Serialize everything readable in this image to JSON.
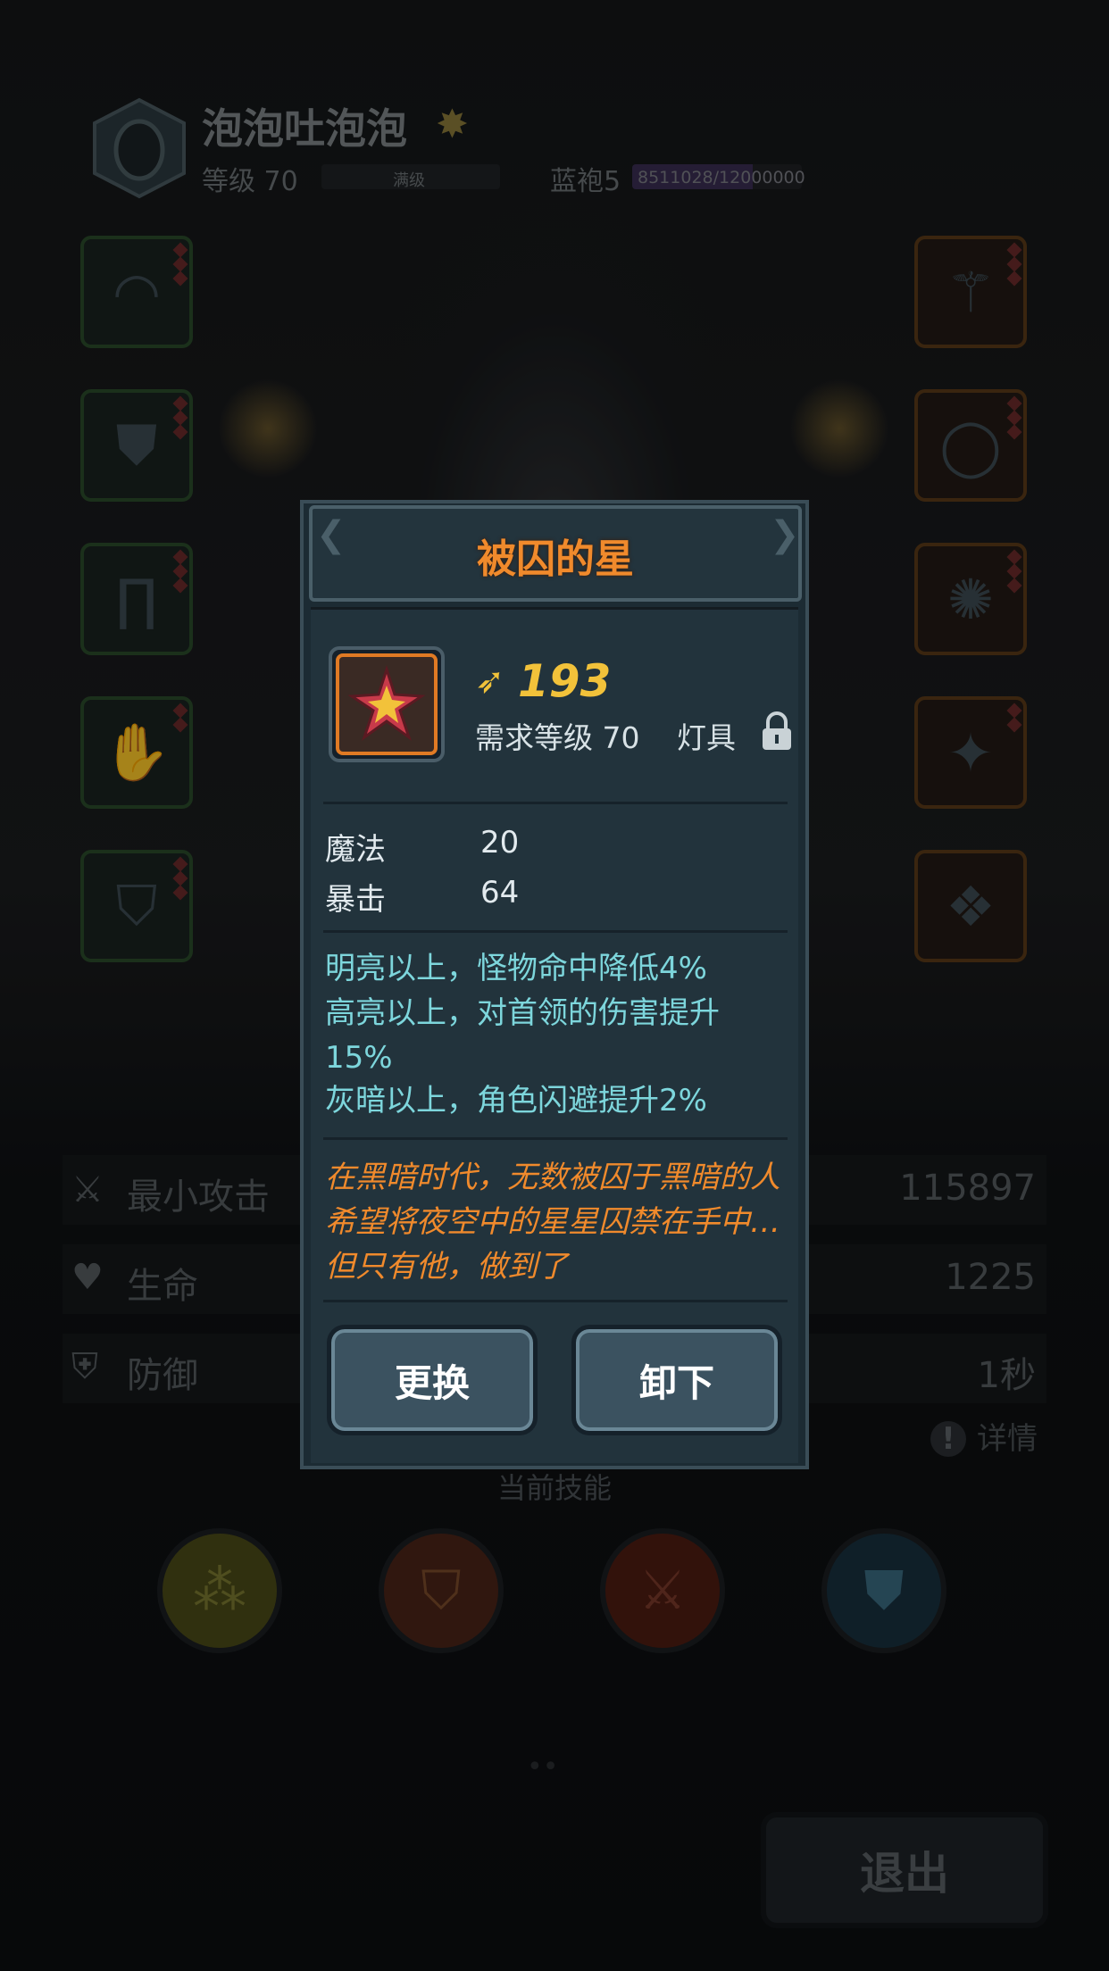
{
  "header": {
    "player_name": "泡泡吐泡泡",
    "level_text": "等级 70",
    "max_level_label": "满级",
    "rank": "蓝袍5",
    "xp_text": "8511028/12000000",
    "xp_progress": 0.709
  },
  "left_slots": [
    {
      "icon": "hood-icon"
    },
    {
      "icon": "robe-icon"
    },
    {
      "icon": "pants-icon"
    },
    {
      "icon": "glove-icon"
    },
    {
      "icon": "cape-icon"
    }
  ],
  "right_slots": [
    {
      "icon": "staff-icon"
    },
    {
      "icon": "ring-icon"
    },
    {
      "icon": "necklace-icon"
    },
    {
      "icon": "star-lamp-icon"
    },
    {
      "icon": "charm-icon"
    }
  ],
  "stats": [
    {
      "label": "最小攻击",
      "value": "115897",
      "icon": "attack-icon"
    },
    {
      "label": "生命",
      "value": "1225",
      "icon": "heart-icon"
    },
    {
      "label": "防御",
      "value": "1秒",
      "icon": "shield-icon"
    }
  ],
  "details_label": "详情",
  "skills_title": "当前技能",
  "skills": [
    {
      "icon": "bubbles-skill-icon",
      "color": "#5d5a1a"
    },
    {
      "icon": "fire-shield-skill-icon",
      "color": "#5a2a1a"
    },
    {
      "icon": "crossed-axes-skill-icon",
      "color": "#5a1f14"
    },
    {
      "icon": "water-shield-skill-icon",
      "color": "#1c3a4a"
    }
  ],
  "exit_label": "退出",
  "modal": {
    "title": "被囚的星",
    "power": "193",
    "requirement": "需求等级 70",
    "item_type": "灯具",
    "attributes": [
      {
        "name": "魔法",
        "value": "20"
      },
      {
        "name": "暴击",
        "value": "64"
      }
    ],
    "effects": [
      "明亮以上，怪物命中降低4%",
      "高亮以上，对首领的伤害提升15%",
      "灰暗以上，角色闪避提升2%"
    ],
    "lore": "在黑暗时代，无数被囚于黑暗的人希望将夜空中的星星囚禁在手中…但只有他，做到了",
    "replace_label": "更换",
    "unequip_label": "卸下"
  },
  "colors": {
    "title_orange": "#f08a2c",
    "power_gold": "#f2c23a",
    "effect_cyan": "#7dd6dc",
    "lore_orange": "#f08a2c",
    "button_bg": "#3b5260"
  }
}
